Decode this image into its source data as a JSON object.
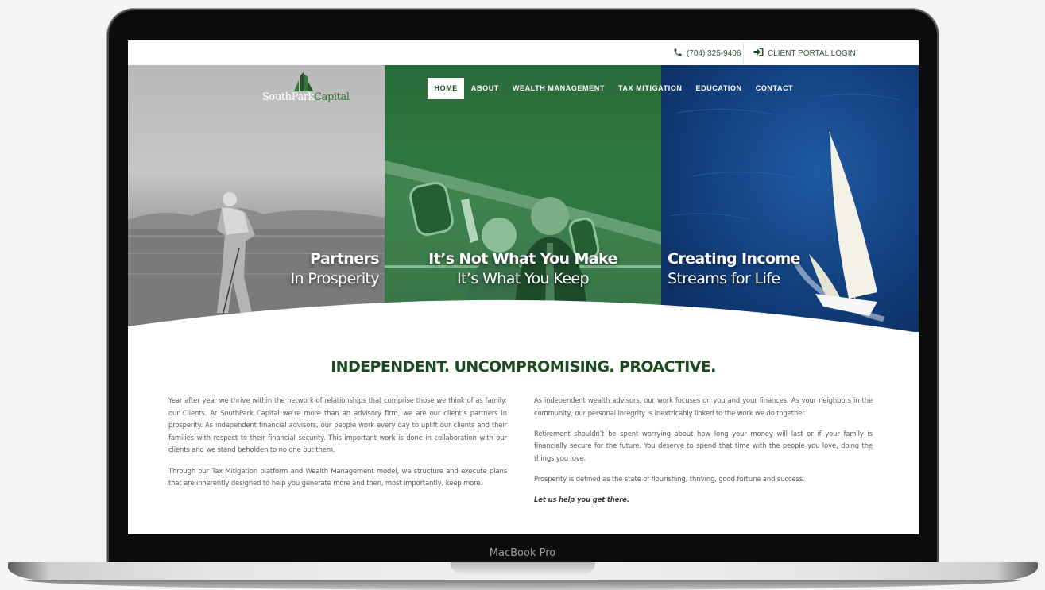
{
  "device": {
    "label": "MacBook Pro"
  },
  "colors": {
    "brand_green": "#1c4a1f",
    "link_green": "#2c5a2e",
    "jet_overlay": "#2f7a42",
    "sea_blue": "#123f7c"
  },
  "topbar": {
    "phone_icon": "phone-icon",
    "phone": "(704) 325-9406",
    "portal_icon": "sign-in-icon",
    "portal": "CLIENT PORTAL LOGIN"
  },
  "logo": {
    "part1": "SouthPark",
    "part2": "Capital"
  },
  "nav": {
    "items": [
      "HOME",
      "ABOUT",
      "WEALTH MANAGEMENT",
      "TAX MITIGATION",
      "EDUCATION",
      "CONTACT"
    ],
    "active": "HOME"
  },
  "hero": {
    "panels": [
      {
        "line1": "Partners",
        "line2": "In Prosperity"
      },
      {
        "line1": "It’s Not What You Make",
        "line2": "It’s What You Keep"
      },
      {
        "line1": "Creating Income",
        "line2": "Streams for Life"
      }
    ]
  },
  "headline": "INDEPENDENT. UNCOMPROMISING. PROACTIVE.",
  "left_column": [
    "Year after year we thrive within the network of relationships that comprise those we think of as family: our Clients. At SouthPark Capital we’re more than an advisory firm, we are our client’s partners in prosperity. As independent financial advisors, our people work every day to uplift our clients and their families with respect to their financial security. This important work is done in collaboration with our clients and we stand beholden to no one but them.",
    "Through our Tax Mitigation platform and Wealth Management model, we structure and execute plans that are inherently designed to help you generate more and then, most importantly, keep more."
  ],
  "right_column": [
    "As independent wealth advisors, our work focuses on you and your finances. As your neighbors in the community, our personal integrity is inextricably linked to the work we do together.",
    "Retirement shouldn’t be spent worrying about how long your money will last or if your family is financially secure for the future. You deserve to spend that time with the people you love, doing the things you love.",
    "Prosperity is defined as the state of flourishing, thriving, good fortune and success."
  ],
  "closing": "Let us help you get there."
}
